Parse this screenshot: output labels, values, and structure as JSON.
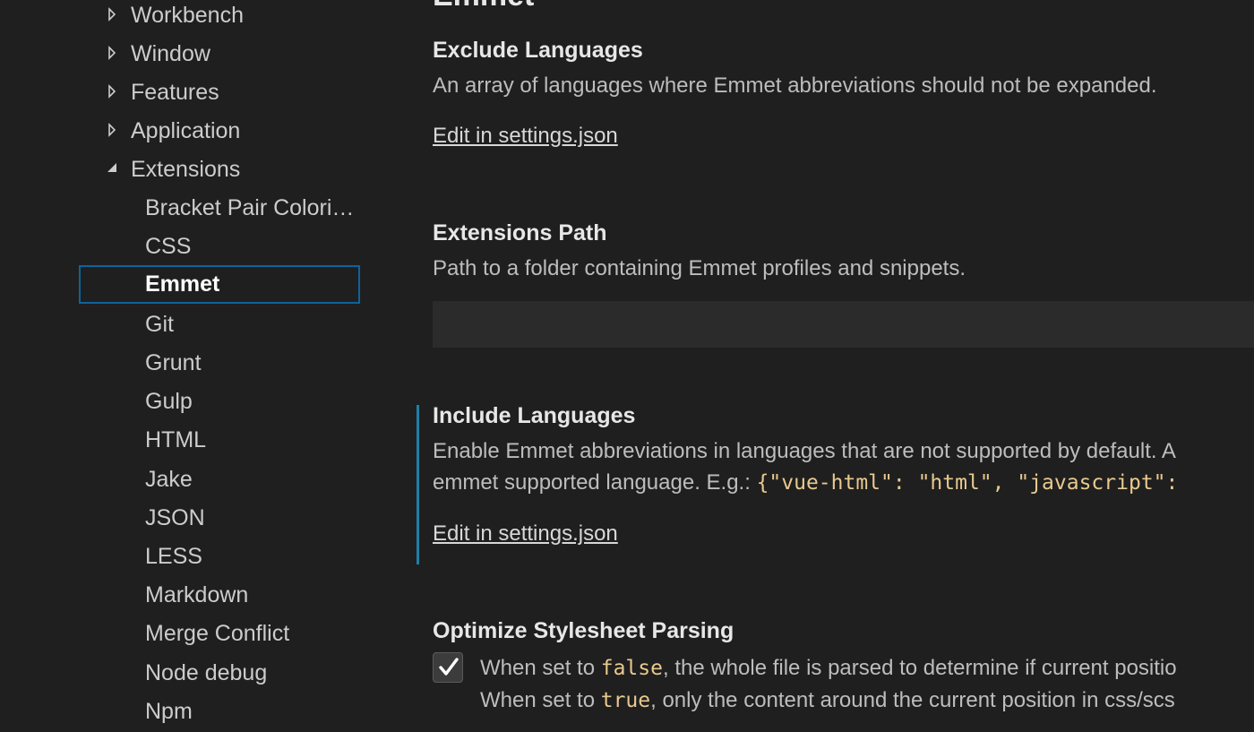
{
  "toc": {
    "items": [
      {
        "label": "Workbench",
        "expanded": false
      },
      {
        "label": "Window",
        "expanded": false
      },
      {
        "label": "Features",
        "expanded": false
      },
      {
        "label": "Application",
        "expanded": false
      },
      {
        "label": "Extensions",
        "expanded": true
      }
    ],
    "extensions_children": [
      "Bracket Pair Colorizer",
      "CSS",
      "Emmet",
      "Git",
      "Grunt",
      "Gulp",
      "HTML",
      "Jake",
      "JSON",
      "LESS",
      "Markdown",
      "Merge Conflict",
      "Node debug",
      "Npm"
    ],
    "selected": "Emmet"
  },
  "content": {
    "group_title": "Emmet",
    "exclude_languages": {
      "title": "Exclude Languages",
      "description": "An array of languages where Emmet abbreviations should not be expanded.",
      "link": "Edit in settings.json"
    },
    "extensions_path": {
      "title": "Extensions Path",
      "description": "Path to a folder containing Emmet profiles and snippets.",
      "value": ""
    },
    "include_languages": {
      "title": "Include Languages",
      "description_line1": "Enable Emmet abbreviations in languages that are not supported by default. A",
      "description_line2_prefix": "emmet supported language. E.g.: ",
      "description_line2_code": "{\"vue-html\": \"html\", \"javascript\":",
      "link": "Edit in settings.json",
      "modified": true
    },
    "optimize_stylesheet_parsing": {
      "title": "Optimize Stylesheet Parsing",
      "checked": true,
      "line1_prefix": "When set to ",
      "line1_code": "false",
      "line1_suffix": ", the whole file is parsed to determine if current positio",
      "line2_prefix": "When set to ",
      "line2_code": "true",
      "line2_suffix": ", only the content around the current position in css/scs"
    }
  },
  "colors": {
    "background": "#1f1f1f",
    "selection_border": "#0e639c",
    "modified_indicator": "#1f7fa8",
    "code_text": "#e8c98f",
    "input_background": "#2b2b2b"
  }
}
